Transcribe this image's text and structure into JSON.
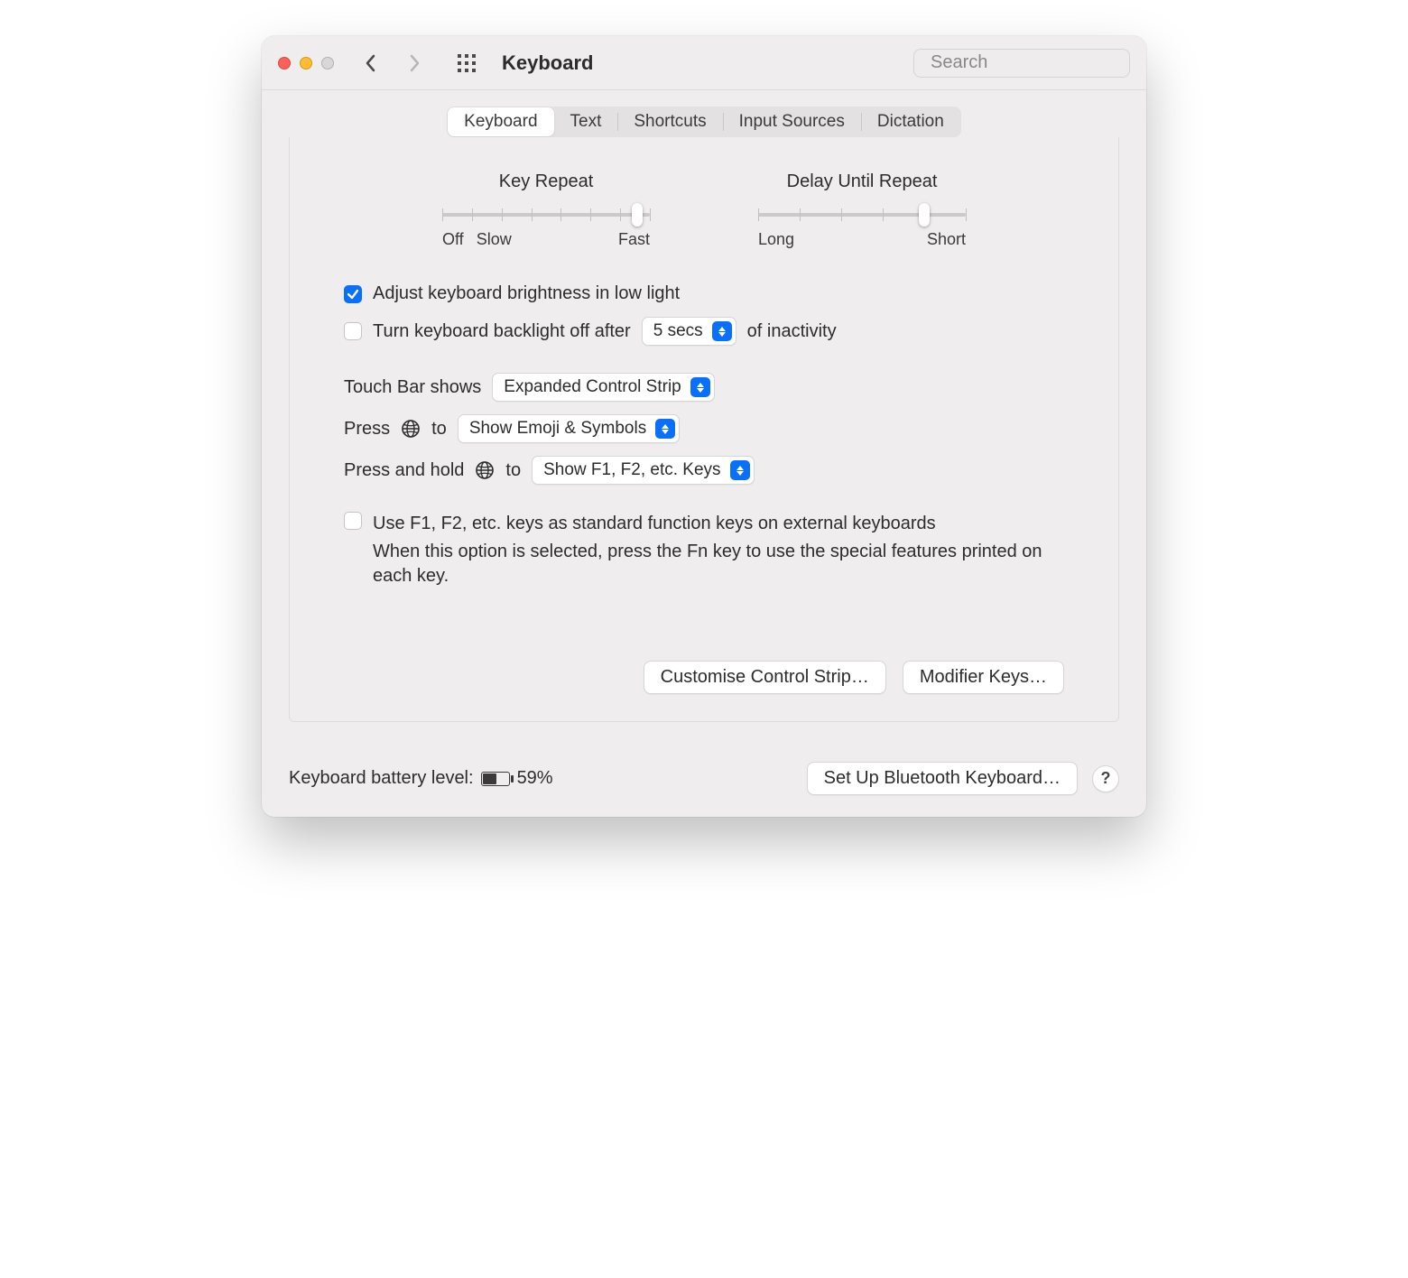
{
  "window": {
    "title": "Keyboard"
  },
  "search": {
    "placeholder": "Search"
  },
  "tabs": [
    "Keyboard",
    "Text",
    "Shortcuts",
    "Input Sources",
    "Dictation"
  ],
  "active_tab": 0,
  "sliders": {
    "key_repeat": {
      "title": "Key Repeat",
      "left_label": "Off",
      "left_label2": "Slow",
      "right_label": "Fast",
      "ticks": 8,
      "value_pct": 94
    },
    "delay_until_repeat": {
      "title": "Delay Until Repeat",
      "left_label": "Long",
      "right_label": "Short",
      "ticks": 6,
      "value_pct": 80
    }
  },
  "opts": {
    "adjust_brightness": {
      "checked": true,
      "label": "Adjust keyboard brightness in low light"
    },
    "backlight_off": {
      "checked": false,
      "label_before": "Turn keyboard backlight off after",
      "value": "5 secs",
      "label_after": "of inactivity"
    },
    "touch_bar": {
      "label": "Touch Bar shows",
      "value": "Expanded Control Strip"
    },
    "press_globe": {
      "label_before": "Press",
      "label_after": "to",
      "value": "Show Emoji & Symbols"
    },
    "hold_globe": {
      "label_before": "Press and hold",
      "label_after": "to",
      "value": "Show F1, F2, etc. Keys"
    },
    "fn_std": {
      "checked": false,
      "label": "Use F1, F2, etc. keys as standard function keys on external keyboards",
      "help": "When this option is selected, press the Fn key to use the special features printed on each key."
    }
  },
  "panel_buttons": {
    "customise": "Customise Control Strip…",
    "modifier": "Modifier Keys…"
  },
  "bottom": {
    "battery_label": "Keyboard battery level:",
    "battery_pct": "59%",
    "battery_fill_pct": 59,
    "bluetooth": "Set Up Bluetooth Keyboard…",
    "help": "?"
  }
}
